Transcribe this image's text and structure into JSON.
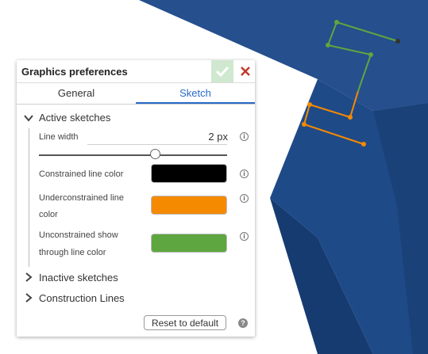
{
  "panel": {
    "title": "Graphics preferences",
    "ok_icon": "check-icon",
    "close_icon": "close-icon"
  },
  "tabs": [
    {
      "label": "General",
      "active": false
    },
    {
      "label": "Sketch",
      "active": true
    }
  ],
  "active_sketches": {
    "label": "Active sketches",
    "expanded": true,
    "line_width_label": "Line width",
    "line_width_value": "2 px",
    "slider_level": 0.62,
    "constrained_label": "Constrained line color",
    "constrained_color": "#000000",
    "underconstrained_label_1": "Underconstrained line",
    "underconstrained_label_2": "color",
    "underconstrained_color": "#f58a00",
    "unconstrained_label_1": "Unconstrained show",
    "unconstrained_label_2": "through line color",
    "unconstrained_color": "#5ea63f",
    "info_glyph": "i"
  },
  "inactive_sketches": {
    "label": "Inactive sketches",
    "expanded": false
  },
  "construction_lines": {
    "label": "Construction Lines",
    "expanded": false
  },
  "footer": {
    "reset_label": "Reset to default",
    "help_glyph": "?"
  },
  "colors": {
    "accent": "#2a6ac8",
    "model_blue": "#1e4d8c",
    "close_red": "#c0392b",
    "ok_green": "#cfe8cf"
  }
}
